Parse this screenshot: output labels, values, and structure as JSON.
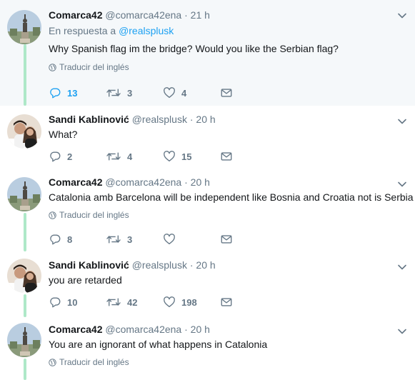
{
  "colors": {
    "accent": "#1da1f2",
    "muted": "#657786",
    "thread_line": "#aee8c8",
    "highlight_bg": "#f5f8fa"
  },
  "tweets": [
    {
      "name": "Comarca42",
      "handle": "@comarca42ena",
      "dot": "·",
      "time": "21 h",
      "reply_prefix": "En respuesta a",
      "reply_mention": "@realsplusk",
      "text": "Why  Spanish flag im the bridge? Would you like the Serbian flag?",
      "translate": "Traducir del inglés",
      "replies": "13",
      "retweets": "3",
      "likes": "4",
      "avatar": "statue-avatar"
    },
    {
      "name": "Sandi Kablinović",
      "handle": "@realsplusk",
      "dot": "·",
      "time": "20 h",
      "text": "What?",
      "replies": "2",
      "retweets": "4",
      "likes": "15",
      "avatar": "couple-avatar"
    },
    {
      "name": "Comarca42",
      "handle": "@comarca42ena",
      "dot": "·",
      "time": "20 h",
      "text": "Catalonia amb Barcelona will be independent like Bosnia and Croatia not is Serbia",
      "translate": "Traducir del inglés",
      "replies": "8",
      "retweets": "3",
      "likes": "",
      "avatar": "statue-avatar"
    },
    {
      "name": "Sandi Kablinović",
      "handle": "@realsplusk",
      "dot": "·",
      "time": "20 h",
      "text": "you are retarded",
      "replies": "10",
      "retweets": "42",
      "likes": "198",
      "avatar": "couple-avatar"
    },
    {
      "name": "Comarca42",
      "handle": "@comarca42ena",
      "dot": "·",
      "time": "20 h",
      "text": "You are an ignorant of what happens in Catalonia",
      "translate": "Traducir del inglés",
      "avatar": "statue-avatar"
    }
  ]
}
